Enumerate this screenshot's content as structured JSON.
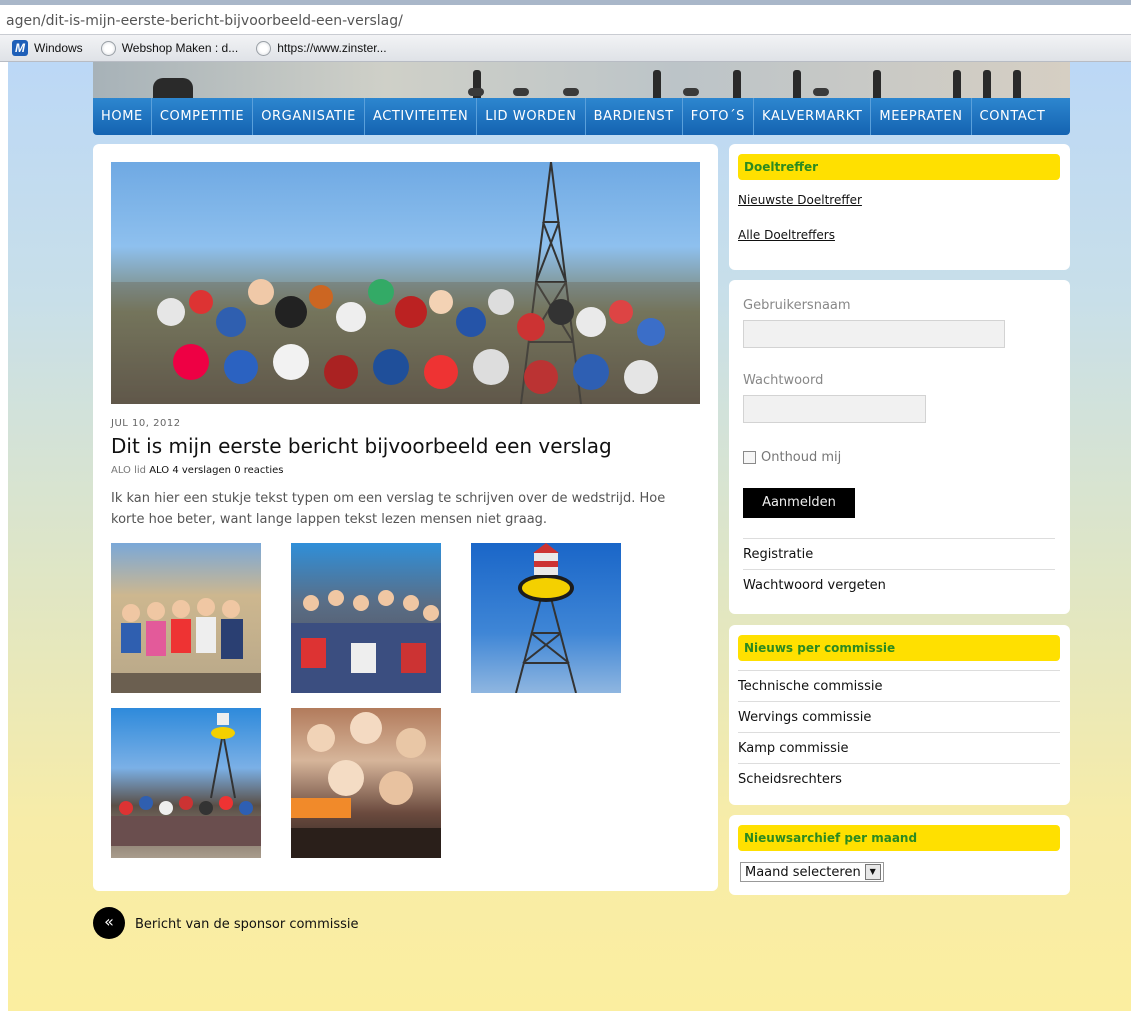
{
  "browser": {
    "url": "agen/dit-is-mijn-eerste-bericht-bijvoorbeeld-een-verslag/",
    "favorites": [
      {
        "label": "Windows",
        "icon": "windows-live-icon"
      },
      {
        "label": "Webshop Maken : d...",
        "icon": "globe-icon"
      },
      {
        "label": "https://www.zinster...",
        "icon": "globe-icon"
      }
    ]
  },
  "nav": {
    "items": [
      "HOME",
      "COMPETITIE",
      "ORGANISATIE",
      "ACTIVITEITEN",
      "LID WORDEN",
      "BARDIENST",
      "FOTO´S",
      "KALVERMARKT",
      "MEEPRATEN",
      "CONTACT"
    ]
  },
  "post": {
    "date": "JUL 10, 2012",
    "title": "Dit is mijn eerste bericht bijvoorbeeld een verslag",
    "author_prefix": "ALO lid",
    "author": "ALO",
    "posts_count": "4 verslagen",
    "comments": "0 reacties",
    "excerpt": "Ik kan hier een stukje tekst typen om een verslag te schrijven over de wedstrijd. Hoe korte hoe beter, want lange lappen tekst lezen mensen niet graag."
  },
  "sidebar": {
    "doeltreffer": {
      "title": "Doeltreffer",
      "links": [
        "Nieuwste Doeltreffer",
        "Alle Doeltreffers"
      ]
    },
    "login": {
      "username_label": "Gebruikersnaam",
      "password_label": "Wachtwoord",
      "remember_label": "Onthoud mij",
      "submit_label": "Aanmelden",
      "links": [
        "Registratie",
        "Wachtwoord vergeten"
      ]
    },
    "news": {
      "title": "Nieuws per commissie",
      "items": [
        "Technische commissie",
        "Wervings commissie",
        "Kamp commissie",
        "Scheidsrechters"
      ]
    },
    "archive": {
      "title": "Nieuwsarchief per maand",
      "selected": "Maand selecteren"
    }
  },
  "prev_post": {
    "icon": "«",
    "label": "Bericht van de sponsor commissie"
  }
}
